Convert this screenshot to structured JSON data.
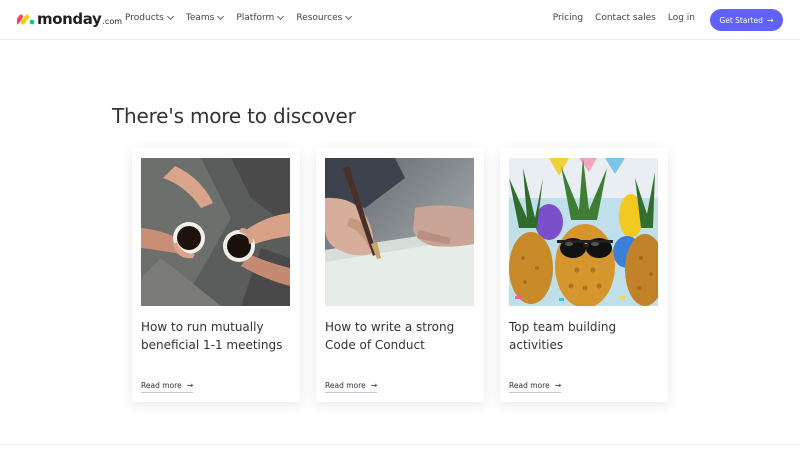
{
  "brand": {
    "name": "monday",
    "suffix": ".com"
  },
  "nav": {
    "items": [
      {
        "label": "Products"
      },
      {
        "label": "Teams"
      },
      {
        "label": "Platform"
      },
      {
        "label": "Resources"
      }
    ],
    "right": {
      "pricing": "Pricing",
      "contact": "Contact sales",
      "login": "Log in"
    },
    "cta": "Get Started"
  },
  "section": {
    "heading": "There's more to discover",
    "cards": [
      {
        "title": "How to run mutually beneficial 1-1 meetings",
        "link": "Read more",
        "image": "coffee-cups-photo"
      },
      {
        "title": "How to write a strong Code of Conduct",
        "link": "Read more",
        "image": "writing-pen-photo"
      },
      {
        "title": "Top team building activities",
        "link": "Read more",
        "image": "pineapples-sunglasses-photo"
      }
    ]
  },
  "colors": {
    "accent": "#6161ff",
    "text": "#323338"
  },
  "icons": {
    "arrow": "arrow-right-icon",
    "chevron": "chevron-down-icon"
  }
}
